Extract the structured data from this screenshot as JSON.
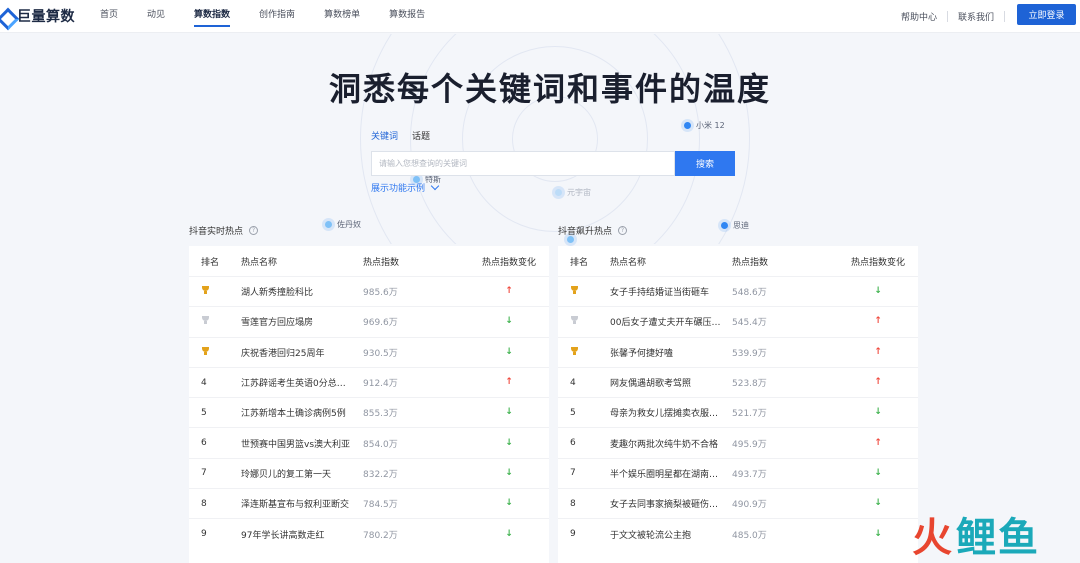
{
  "brand": {
    "name": "巨量算数"
  },
  "nav": [
    {
      "label": "首页",
      "active": false
    },
    {
      "label": "动见",
      "active": false
    },
    {
      "label": "算数指数",
      "active": true
    },
    {
      "label": "创作指南",
      "active": false
    },
    {
      "label": "算数榜单",
      "active": false
    },
    {
      "label": "算数报告",
      "active": false
    }
  ],
  "header": {
    "help": "帮助中心",
    "contact": "联系我们",
    "login": "立即登录"
  },
  "hero": {
    "title": "洞悉每个关键词和事件的温度",
    "tabs": [
      {
        "label": "关键词",
        "active": true
      },
      {
        "label": "话题",
        "active": false
      }
    ],
    "search_placeholder": "请输入您想查询的关键词",
    "search_button": "搜索",
    "demo_link": "展示功能示例",
    "floating_tags": [
      "小米 12",
      "特斯",
      "元宇宙",
      "佐丹奴",
      "思迪"
    ]
  },
  "left_table": {
    "title": "抖音实时热点",
    "columns": [
      "排名",
      "热点名称",
      "热点指数",
      "热点指数变化"
    ],
    "rows": [
      {
        "rank": "",
        "medal": "gold",
        "name": "湖人新秀撞脸科比",
        "index": "985.6万",
        "change": "up"
      },
      {
        "rank": "",
        "medal": "silver",
        "name": "雪莲官方回应塌房",
        "index": "969.6万",
        "change": "down"
      },
      {
        "rank": "",
        "medal": "gold",
        "name": "庆祝香港回归25周年",
        "index": "930.5万",
        "change": "down"
      },
      {
        "rank": "4",
        "medal": "",
        "name": "江苏辟谣考生英语0分总…",
        "index": "912.4万",
        "change": "up"
      },
      {
        "rank": "5",
        "medal": "",
        "name": "江苏新增本土确诊病例5例",
        "index": "855.3万",
        "change": "down"
      },
      {
        "rank": "6",
        "medal": "",
        "name": "世预赛中国男篮vs澳大利亚",
        "index": "854.0万",
        "change": "down"
      },
      {
        "rank": "7",
        "medal": "",
        "name": "玲娜贝儿的复工第一天",
        "index": "832.2万",
        "change": "down"
      },
      {
        "rank": "8",
        "medal": "",
        "name": "泽连斯基宣布与叙利亚断交",
        "index": "784.5万",
        "change": "down"
      },
      {
        "rank": "9",
        "medal": "",
        "name": "97年学长讲高数走红",
        "index": "780.2万",
        "change": "down"
      }
    ]
  },
  "right_table": {
    "title": "抖音飙升热点",
    "columns": [
      "排名",
      "热点名称",
      "热点指数",
      "热点指数变化"
    ],
    "rows": [
      {
        "rank": "",
        "medal": "gold",
        "name": "女子手持结婚证当街砸车",
        "index": "548.6万",
        "change": "down"
      },
      {
        "rank": "",
        "medal": "silver",
        "name": "00后女子遭丈夫开车碾压…",
        "index": "545.4万",
        "change": "up"
      },
      {
        "rank": "",
        "medal": "gold",
        "name": "张馨予何捷好嗑",
        "index": "539.9万",
        "change": "up"
      },
      {
        "rank": "4",
        "medal": "",
        "name": "网友偶遇胡歌考驾照",
        "index": "523.8万",
        "change": "up"
      },
      {
        "rank": "5",
        "medal": "",
        "name": "母亲为救女儿摆摊卖衣服…",
        "index": "521.7万",
        "change": "down"
      },
      {
        "rank": "6",
        "medal": "",
        "name": "麦趣尔两批次纯牛奶不合格",
        "index": "495.9万",
        "change": "up"
      },
      {
        "rank": "7",
        "medal": "",
        "name": "半个娱乐圈明星都在湖南…",
        "index": "493.7万",
        "change": "down"
      },
      {
        "rank": "8",
        "medal": "",
        "name": "女子去同事家摘梨被砸伤…",
        "index": "490.9万",
        "change": "down"
      },
      {
        "rank": "9",
        "medal": "",
        "name": "于文文被轮流公主抱",
        "index": "485.0万",
        "change": "down"
      }
    ]
  },
  "watermark": {
    "part1": "火",
    "part2": "鲤鱼"
  },
  "colors": {
    "accent": "#1e63d6",
    "up": "#f04a3e",
    "down": "#3fb24e",
    "gold": "#e3a21b",
    "silver": "#c9ccd3"
  }
}
